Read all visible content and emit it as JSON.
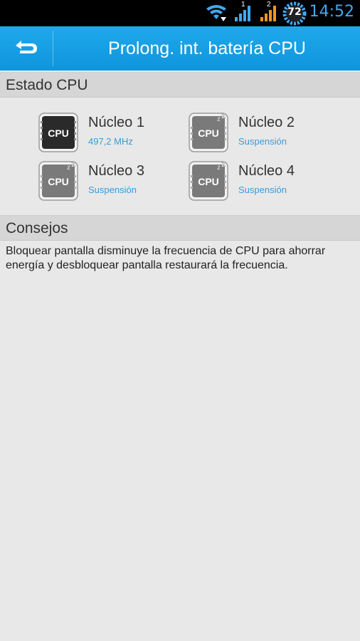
{
  "status_bar": {
    "icons": [
      "wifi-icon",
      "signal-1-icon",
      "signal-2-icon",
      "battery-icon"
    ],
    "signal_labels": [
      "1",
      "2"
    ],
    "battery_level": "72",
    "time": "14:52",
    "accent_color": "#3fa9f5"
  },
  "action_bar": {
    "back_icon": "back-arrow-icon",
    "title": "Prolong. int. batería CPU",
    "color": "#1ea9ec"
  },
  "cpu_section": {
    "title": "Estado CPU",
    "cores": [
      {
        "name": "Núcleo 1",
        "status": "497,2 MHz",
        "chip_label": "CPU",
        "sleeping": false
      },
      {
        "name": "Núcleo 2",
        "status": "Suspensión",
        "chip_label": "CPU",
        "sleeping": true
      },
      {
        "name": "Núcleo 3",
        "status": "Suspensión",
        "chip_label": "CPU",
        "sleeping": true
      },
      {
        "name": "Núcleo 4",
        "status": "Suspensión",
        "chip_label": "CPU",
        "sleeping": true
      }
    ]
  },
  "tips_section": {
    "title": "Consejos",
    "text": "Bloquear pantalla disminuye la frecuencia de CPU para ahorrar energía y desbloquear pantalla restaurará la frecuencia."
  }
}
